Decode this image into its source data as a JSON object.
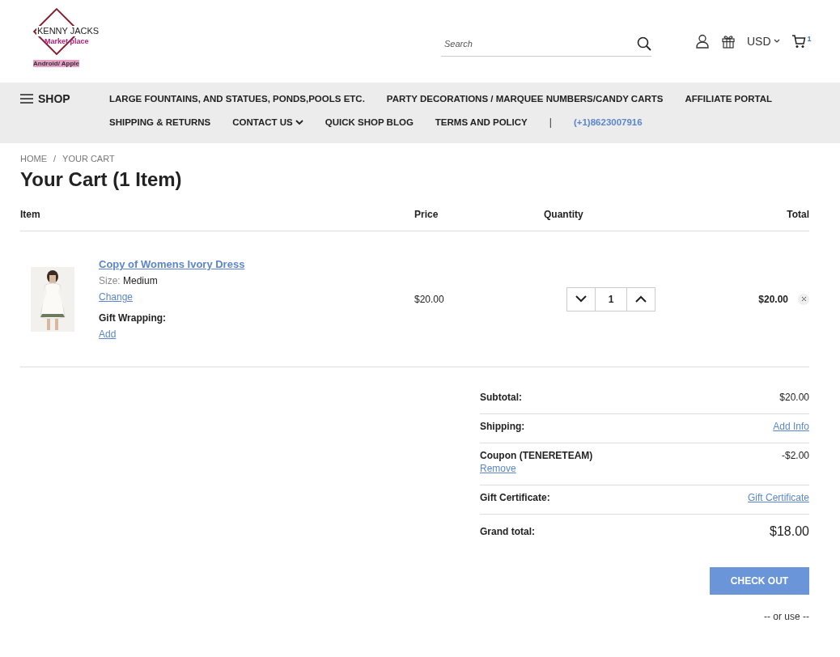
{
  "logo": {
    "line_1": "KENNY JACKS",
    "line_2": "Market place",
    "line_3": "Android/ Apple"
  },
  "search": {
    "placeholder": "Search"
  },
  "header": {
    "currency": "USD",
    "cart_count": "1"
  },
  "nav": {
    "shop": "SHOP",
    "row_1": [
      "LARGE FOUNTAINS, AND STATUES, PONDS,POOLS ETC.",
      "PARTY DECORATIONS / MARQUEE NUMBERS/CANDY CARTS",
      "AFFILIATE PORTAL"
    ],
    "row_2": [
      {
        "label": "SHIPPING & RETURNS",
        "dropdown": false
      },
      {
        "label": "CONTACT US",
        "dropdown": true
      },
      {
        "label": "QUICK SHOP BLOG",
        "dropdown": false
      },
      {
        "label": "TERMS AND POLICY",
        "dropdown": false
      }
    ],
    "separator": "|",
    "phone": "(+1)8623007916"
  },
  "breadcrumbs": [
    "HOME",
    "YOUR CART"
  ],
  "breadcrumb_separator": "/",
  "title": "Your Cart (1 Item)",
  "table": {
    "columns": [
      "Item",
      "Price",
      "Quantity",
      "Total"
    ],
    "rows": [
      {
        "name": "Copy of Womens Ivory Dress",
        "option_label": "Size:",
        "option_value": "Medium",
        "change": "Change",
        "gift_label": "Gift Wrapping:",
        "gift_action": "Add",
        "price": "$20.00",
        "quantity": "1",
        "total": "$20.00"
      }
    ]
  },
  "summary": [
    {
      "kind": "value",
      "label": "Subtotal:",
      "value": "$20.00"
    },
    {
      "kind": "link",
      "label": "Shipping:",
      "value": "Add Info"
    },
    {
      "kind": "coupon",
      "label": "Coupon (TENERETEAM)",
      "value": "-$2.00",
      "action": "Remove"
    },
    {
      "kind": "link",
      "label": "Gift Certificate:",
      "value": "Gift Certificate"
    },
    {
      "kind": "grand",
      "label": "Grand total:",
      "value": "$18.00"
    }
  ],
  "checkout": "CHECK OUT",
  "or_use": "-- or use --"
}
